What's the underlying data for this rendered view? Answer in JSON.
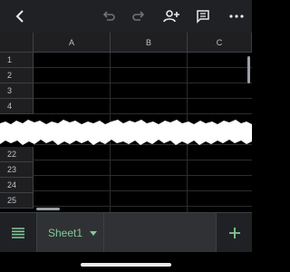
{
  "toolbar": {
    "icons": [
      "back-icon",
      "undo-icon",
      "redo-icon",
      "add-person-icon",
      "comment-icon",
      "more-icon"
    ]
  },
  "grid": {
    "columns": [
      "A",
      "B",
      "C"
    ],
    "rows_top": [
      "1",
      "2",
      "3",
      "4"
    ],
    "rows_bottom": [
      "22",
      "23",
      "24",
      "25"
    ]
  },
  "sheets": {
    "active_tab": "Sheet1"
  },
  "colors": {
    "accent": "#81c995",
    "toolbar_bg": "#202124",
    "cell_bg": "#000000"
  }
}
